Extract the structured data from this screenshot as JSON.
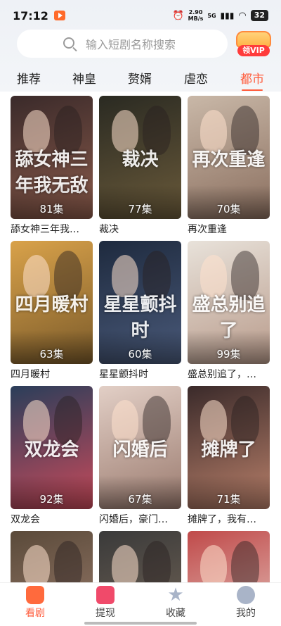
{
  "status_bar": {
    "time": "17:12",
    "net_speed_value": "2.90",
    "net_speed_unit": "MB/s",
    "network": "5G",
    "battery": "32"
  },
  "search": {
    "placeholder": "输入短剧名称搜索"
  },
  "vip": {
    "label": "领VIP"
  },
  "tabs": [
    {
      "label": "推荐"
    },
    {
      "label": "神皇"
    },
    {
      "label": "赘婿"
    },
    {
      "label": "虐恋"
    },
    {
      "label": "都市"
    }
  ],
  "dramas": [
    {
      "title": "舔女神三年我…",
      "episodes": "81集",
      "poster_text": "舔女神三年我无敌",
      "colors": [
        "#3a2a2a",
        "#8a5a4a"
      ]
    },
    {
      "title": "裁决",
      "episodes": "77集",
      "poster_text": "裁决",
      "colors": [
        "#2a2a22",
        "#6a5a3a"
      ]
    },
    {
      "title": "再次重逢",
      "episodes": "70集",
      "poster_text": "再次重逢",
      "colors": [
        "#c9b8a8",
        "#8a6e5e"
      ]
    },
    {
      "title": "四月暖村",
      "episodes": "63集",
      "poster_text": "四月暖村",
      "colors": [
        "#d9a24a",
        "#7a5a2a"
      ]
    },
    {
      "title": "星星颤抖时",
      "episodes": "60集",
      "poster_text": "星星颤抖时",
      "colors": [
        "#1e2a3e",
        "#4a5a7a"
      ]
    },
    {
      "title": "盛总别追了，…",
      "episodes": "99集",
      "poster_text": "盛总别追了",
      "colors": [
        "#e8e2da",
        "#b89a8a"
      ]
    },
    {
      "title": "双龙会",
      "episodes": "92集",
      "poster_text": "双龙会",
      "colors": [
        "#2a3e5a",
        "#c94a5a"
      ]
    },
    {
      "title": "闪婚后，豪门…",
      "episodes": "67集",
      "poster_text": "闪婚后",
      "colors": [
        "#e2cfc6",
        "#9a7a6e"
      ]
    },
    {
      "title": "摊牌了，我有…",
      "episodes": "71集",
      "poster_text": "摊牌了",
      "colors": [
        "#3a2a2a",
        "#b9806a"
      ]
    },
    {
      "title": "",
      "episodes": "",
      "poster_text": "",
      "colors": [
        "#5a4a3a",
        "#a08070"
      ]
    },
    {
      "title": "",
      "episodes": "",
      "poster_text": "",
      "colors": [
        "#3a3a3a",
        "#7a6a5a"
      ]
    },
    {
      "title": "",
      "episodes": "",
      "poster_text": "",
      "colors": [
        "#c04a4a",
        "#e8d0c8"
      ]
    }
  ],
  "bottom_nav": [
    {
      "label": "看剧",
      "icon": "home-icon",
      "active": true
    },
    {
      "label": "提现",
      "icon": "wallet-icon",
      "active": false
    },
    {
      "label": "收藏",
      "icon": "star-icon",
      "active": false
    },
    {
      "label": "我的",
      "icon": "profile-icon",
      "active": false
    }
  ],
  "accent_color": "#ff5c3c"
}
